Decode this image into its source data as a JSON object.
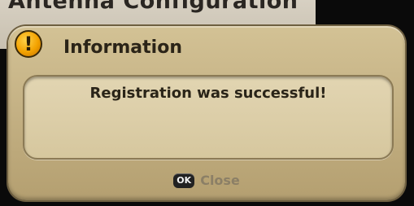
{
  "background": {
    "menu_title": "Antenna Configuration"
  },
  "dialog": {
    "icon": "exclamation-icon",
    "title": "Information",
    "message": "Registration was successful!",
    "close": {
      "key_label": "OK",
      "label": "Close"
    }
  },
  "colors": {
    "dialog": "#c9b78a",
    "message_box": "#dccfa9",
    "icon": "#f3a200",
    "text": "#2b2418",
    "disabled_text": "#8b7f66"
  }
}
